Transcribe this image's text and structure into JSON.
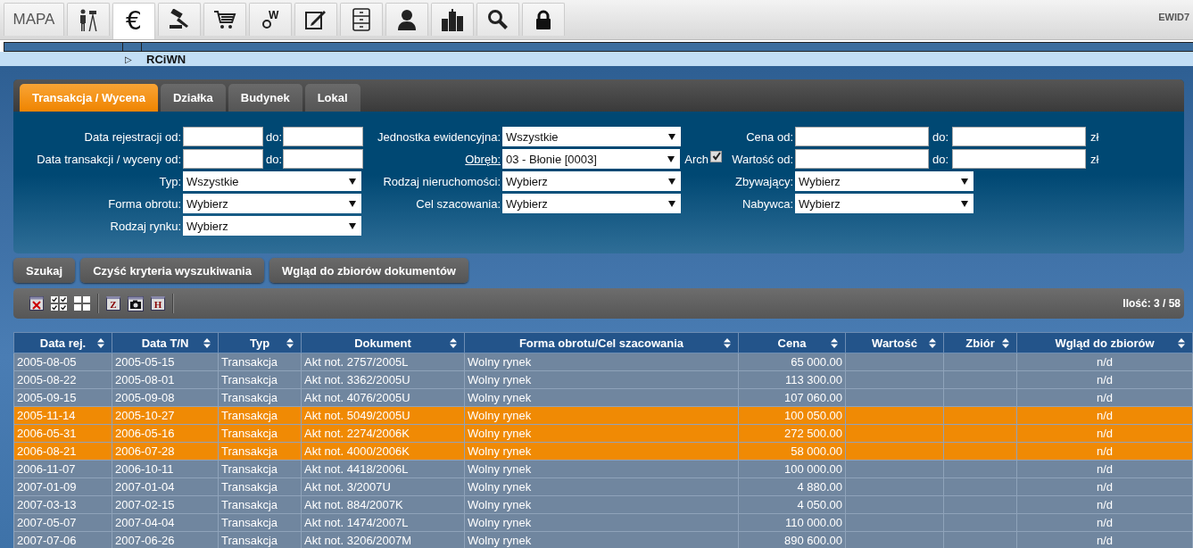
{
  "top_tabs": [
    {
      "kind": "text",
      "label": "MAPA",
      "selected": false
    },
    {
      "kind": "surveyor",
      "selected": false
    },
    {
      "kind": "euro",
      "glyph": "€",
      "selected": true
    },
    {
      "kind": "gavel",
      "selected": false
    },
    {
      "kind": "cart",
      "selected": false
    },
    {
      "kind": "ring",
      "glyph": "W",
      "selected": false
    },
    {
      "kind": "document",
      "selected": false
    },
    {
      "kind": "cabinet",
      "selected": false
    },
    {
      "kind": "person",
      "selected": false
    },
    {
      "kind": "buildings",
      "selected": false
    },
    {
      "kind": "search",
      "selected": false
    },
    {
      "kind": "lock",
      "selected": false
    }
  ],
  "user": "EWID7",
  "breadcrumb": {
    "toggle": "▷",
    "title": "RCiWN"
  },
  "panel_tabs": [
    {
      "label": "Transakcja / Wycena",
      "selected": true
    },
    {
      "label": "Działka",
      "selected": false
    },
    {
      "label": "Budynek",
      "selected": false
    },
    {
      "label": "Lokal",
      "selected": false
    }
  ],
  "filter_rows": [
    {
      "left": {
        "kind": "range",
        "label": "Data rejestracji od:",
        "to_label": "do:"
      },
      "middle": {
        "kind": "select",
        "label": "Jednostka ewidencyjna:",
        "value": "Wszystkie"
      },
      "right": {
        "kind": "range",
        "label": "Cena od:",
        "to_label": "do:",
        "unit": "zł"
      }
    },
    {
      "left": {
        "kind": "range",
        "label": "Data transakcji / wyceny od:",
        "to_label": "do:"
      },
      "middle": {
        "kind": "select",
        "label": "Obręb:",
        "value": "03 - Błonie [0003]",
        "link": true,
        "archive": {
          "label": "Arch",
          "checked": true
        }
      },
      "right": {
        "kind": "range",
        "label": "Wartość od:",
        "to_label": "do:",
        "unit": "zł"
      }
    },
    {
      "left": {
        "kind": "select",
        "label": "Typ:",
        "value": "Wszystkie"
      },
      "middle": {
        "kind": "select",
        "label": "Rodzaj nieruchomości:",
        "value": "Wybierz"
      },
      "right": {
        "kind": "select",
        "label": "Zbywający:",
        "value": "Wybierz"
      }
    },
    {
      "left": {
        "kind": "select",
        "label": "Forma obrotu:",
        "value": "Wybierz"
      },
      "middle": {
        "kind": "select",
        "label": "Cel szacowania:",
        "value": "Wybierz"
      },
      "right": {
        "kind": "select",
        "label": "Nabywca:",
        "value": "Wybierz"
      }
    },
    {
      "left": {
        "kind": "select",
        "label": "Rodzaj rynku:",
        "value": "Wybierz"
      }
    }
  ],
  "actions": [
    "Szukaj",
    "Czyść kryteria wyszukiwania",
    "Wgląd do zbiorów dokumentów"
  ],
  "toolbar": [
    {
      "kind": "clear"
    },
    {
      "kind": "check-all"
    },
    {
      "kind": "grid"
    },
    {
      "kind": "letter",
      "glyph": "Z"
    },
    {
      "kind": "camera"
    },
    {
      "kind": "letter",
      "glyph": "H"
    }
  ],
  "count": "Ilość: 3 / 58",
  "table": {
    "columns": [
      {
        "label": "Data rej."
      },
      {
        "label": "Data T/N"
      },
      {
        "label": "Typ"
      },
      {
        "label": "Dokument"
      },
      {
        "label": "Forma obrotu/Cel szacowania"
      },
      {
        "label": "Cena"
      },
      {
        "label": "Wartość"
      },
      {
        "label": "Zbiór"
      },
      {
        "label": "Wgląd do zbiorów"
      }
    ],
    "rows": [
      {
        "selected": false,
        "cells": [
          "2005-08-05",
          "2005-05-15",
          "Transakcja",
          "Akt not. 2757/2005L",
          "Wolny rynek",
          "65 000.00",
          "",
          "",
          "n/d"
        ]
      },
      {
        "selected": false,
        "cells": [
          "2005-08-22",
          "2005-08-01",
          "Transakcja",
          "Akt not. 3362/2005U",
          "Wolny rynek",
          "113 300.00",
          "",
          "",
          "n/d"
        ]
      },
      {
        "selected": false,
        "cells": [
          "2005-09-15",
          "2005-09-08",
          "Transakcja",
          "Akt not. 4076/2005U",
          "Wolny rynek",
          "107 060.00",
          "",
          "",
          "n/d"
        ]
      },
      {
        "selected": true,
        "cells": [
          "2005-11-14",
          "2005-10-27",
          "Transakcja",
          "Akt not. 5049/2005U",
          "Wolny rynek",
          "100 050.00",
          "",
          "",
          "n/d"
        ]
      },
      {
        "selected": true,
        "cells": [
          "2006-05-31",
          "2006-05-16",
          "Transakcja",
          "Akt not. 2274/2006K",
          "Wolny rynek",
          "272 500.00",
          "",
          "",
          "n/d"
        ]
      },
      {
        "selected": true,
        "cells": [
          "2006-08-21",
          "2006-07-28",
          "Transakcja",
          "Akt not. 4000/2006K",
          "Wolny rynek",
          "58 000.00",
          "",
          "",
          "n/d"
        ]
      },
      {
        "selected": false,
        "cells": [
          "2006-11-07",
          "2006-10-11",
          "Transakcja",
          "Akt not. 4418/2006L",
          "Wolny rynek",
          "100 000.00",
          "",
          "",
          "n/d"
        ]
      },
      {
        "selected": false,
        "cells": [
          "2007-01-09",
          "2007-01-04",
          "Transakcja",
          "Akt not. 3/2007U",
          "Wolny rynek",
          "4 880.00",
          "",
          "",
          "n/d"
        ]
      },
      {
        "selected": false,
        "cells": [
          "2007-03-13",
          "2007-02-15",
          "Transakcja",
          "Akt not. 884/2007K",
          "Wolny rynek",
          "4 050.00",
          "",
          "",
          "n/d"
        ]
      },
      {
        "selected": false,
        "cells": [
          "2007-05-07",
          "2007-04-04",
          "Transakcja",
          "Akt not. 1474/2007L",
          "Wolny rynek",
          "110 000.00",
          "",
          "",
          "n/d"
        ]
      },
      {
        "selected": false,
        "cells": [
          "2007-07-06",
          "2007-06-26",
          "Transakcja",
          "Akt not. 3206/2007M",
          "Wolny rynek",
          "890 600.00",
          "",
          "",
          "n/d"
        ]
      }
    ]
  }
}
